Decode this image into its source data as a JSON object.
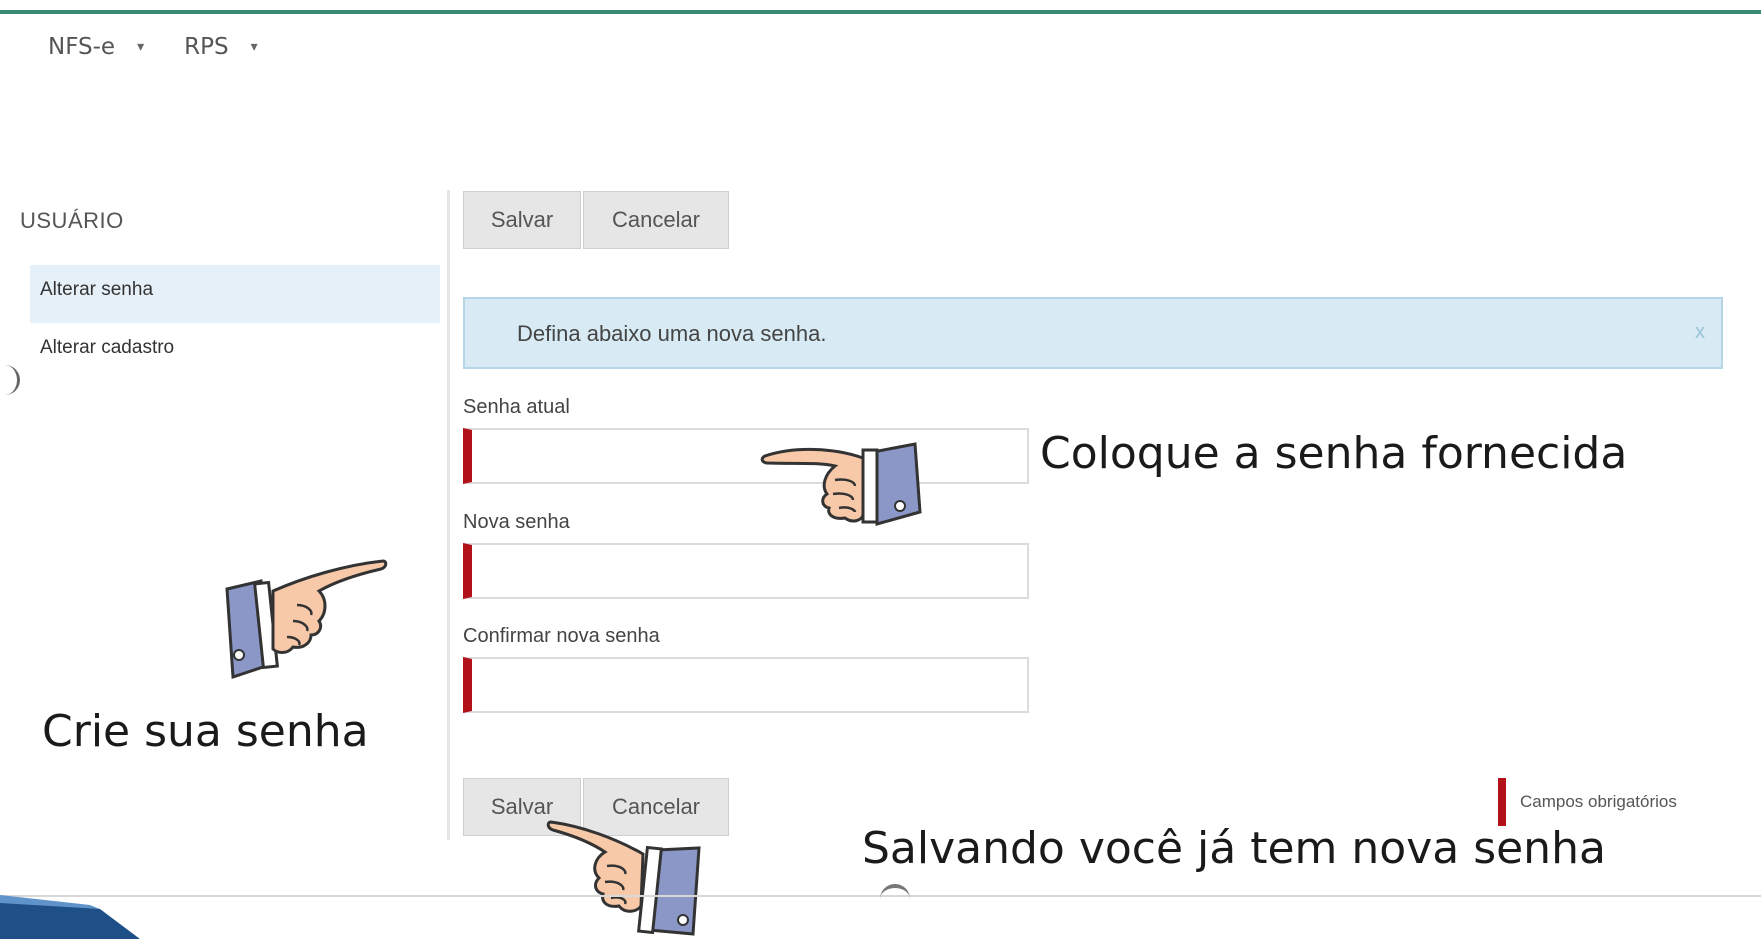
{
  "menu": {
    "items": [
      {
        "label": "NFS-e",
        "caret": "▾"
      },
      {
        "label": "RPS",
        "caret": "▾"
      }
    ]
  },
  "sidebar": {
    "heading": "USUÁRIO",
    "items": [
      {
        "label": "Alterar senha",
        "active": true
      },
      {
        "label": "Alterar cadastro",
        "active": false
      }
    ]
  },
  "toolbar": {
    "save_label": "Salvar",
    "cancel_label": "Cancelar"
  },
  "banner": {
    "text": "Defina abaixo uma nova senha.",
    "close": "x"
  },
  "form": {
    "current_password_label": "Senha atual",
    "new_password_label": "Nova senha",
    "confirm_password_label": "Confirmar nova senha"
  },
  "footer_actions": {
    "save_label": "Salvar",
    "cancel_label": "Cancelar"
  },
  "required_legend": "Campos obrigatórios",
  "annotations": {
    "current_password_hint": "Coloque a senha fornecida",
    "create_password_hint": "Crie sua senha",
    "save_hint": "Salvando você já tem nova senha"
  },
  "colors": {
    "accent_border": "#3b8a74",
    "required": "#b2111a",
    "info_banner": "#d8ebf4",
    "active_sidebar": "#e6f0f8"
  },
  "icons": [
    "pointing-hand-icon",
    "chevron-down-icon",
    "close-icon"
  ]
}
